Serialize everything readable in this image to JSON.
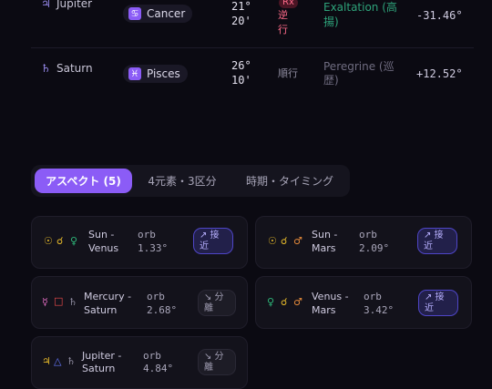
{
  "planets": [
    {
      "symbol": "♃",
      "name": "Jupiter",
      "sign_symbol": "♋",
      "sign": "Cancer",
      "degree_line1": "21°",
      "degree_line2": "20'",
      "rx_label": "Rx",
      "motion_line1": "逆",
      "motion_line2": "行",
      "dignity_line1": "Exaltation (高",
      "dignity_line2": "揚)",
      "score": "-31.46°"
    },
    {
      "symbol": "♄",
      "name": "Saturn",
      "sign_symbol": "♓",
      "sign": "Pisces",
      "degree_line1": "26°",
      "degree_line2": "10'",
      "motion": "順行",
      "dignity_line1": "Peregrine (巡",
      "dignity_line2": "歴)",
      "score": "+12.52°"
    }
  ],
  "tabs": [
    {
      "label": "アスペクト (5)",
      "active": true
    },
    {
      "label": "4元素・3区分",
      "active": false
    },
    {
      "label": "時期・タイミング",
      "active": false
    }
  ],
  "aspects": [
    {
      "symbols": [
        "☉",
        "☌",
        "♀"
      ],
      "pair_line1": "Sun -",
      "pair_line2": "Venus",
      "orb_label": "orb",
      "orb_value": "1.33°",
      "status_line1": "↗ 接",
      "status_line2": "近",
      "status": "applying"
    },
    {
      "symbols": [
        "☉",
        "☌",
        "♂"
      ],
      "pair_line1": "Sun -",
      "pair_line2": "Mars",
      "orb_label": "orb",
      "orb_value": "2.09°",
      "status_line1": "↗ 接",
      "status_line2": "近",
      "status": "applying"
    },
    {
      "symbols": [
        "☿",
        "□",
        "♄"
      ],
      "pair_line1": "Mercury -",
      "pair_line2": "Saturn",
      "orb_label": "orb",
      "orb_value": "2.68°",
      "status_line1": "↘ 分",
      "status_line2": "離",
      "status": "separating"
    },
    {
      "symbols": [
        "♀",
        "☌",
        "♂"
      ],
      "pair_line1": "Venus -",
      "pair_line2": "Mars",
      "orb_label": "orb",
      "orb_value": "3.42°",
      "status_line1": "↗ 接",
      "status_line2": "近",
      "status": "applying"
    },
    {
      "symbols": [
        "♃",
        "△",
        "♄"
      ],
      "pair_line1": "Jupiter -",
      "pair_line2": "Saturn",
      "orb_label": "orb",
      "orb_value": "4.84°",
      "status_line1": "↘ 分",
      "status_line2": "離",
      "status": "separating"
    }
  ],
  "colors": {
    "accent": "#8b5cf6",
    "exaltation": "#2ea37a",
    "retrograde": "#ff6b8a"
  }
}
